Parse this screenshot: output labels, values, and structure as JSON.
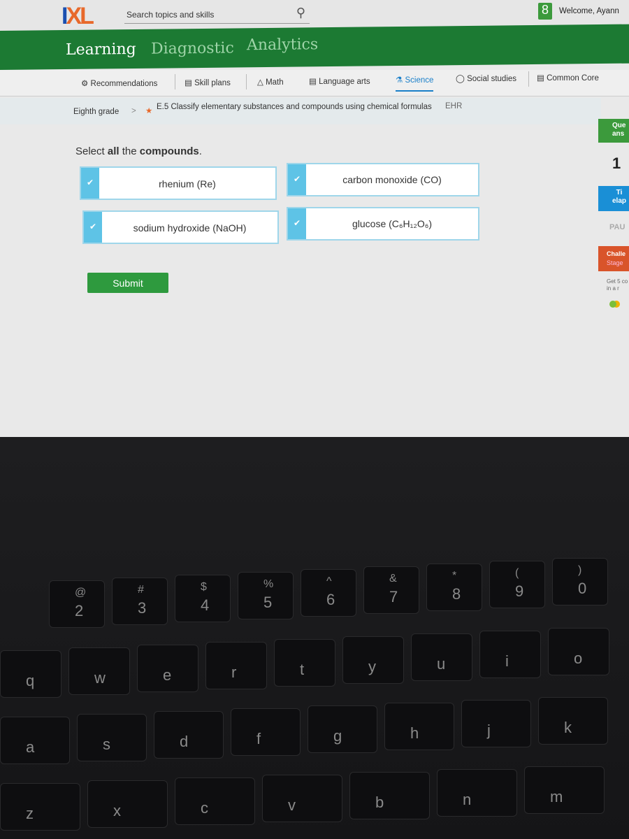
{
  "header": {
    "logo": "IXL",
    "search_placeholder": "Search topics and skills",
    "avatar_glyph": "8",
    "welcome": "Welcome, Ayann"
  },
  "main_nav": [
    {
      "label": "Learning",
      "active": true
    },
    {
      "label": "Diagnostic"
    },
    {
      "label": "Analytics"
    }
  ],
  "sub_nav": [
    {
      "label": "Recommendations",
      "icon": "recommendations-icon"
    },
    {
      "label": "Skill plans",
      "icon": "skill-plans-icon"
    },
    {
      "label": "Math",
      "icon": "math-icon"
    },
    {
      "label": "Language arts",
      "icon": "book-icon"
    },
    {
      "label": "Science",
      "icon": "flask-icon",
      "active": true
    },
    {
      "label": "Social studies",
      "icon": "globe-icon"
    },
    {
      "label": "Common Core",
      "icon": "clipboard-icon"
    }
  ],
  "breadcrumb": {
    "grade": "Eighth grade",
    "separator": ">",
    "skill": "E.5 Classify elementary substances and compounds using chemical formulas",
    "code": "EHR"
  },
  "question": {
    "prompt_pre": "Select ",
    "prompt_bold1": "all",
    "prompt_mid": " the ",
    "prompt_bold2": "compounds",
    "prompt_end": ".",
    "choices": [
      {
        "label": "rhenium (Re)",
        "selected": true
      },
      {
        "label": "carbon monoxide (CO)",
        "selected": true
      },
      {
        "label": "sodium hydroxide (NaOH)",
        "selected": true
      },
      {
        "label": "glucose (C₆H₁₂O₆)",
        "selected": true
      }
    ],
    "submit": "Submit"
  },
  "sidebar": {
    "questions_label": "Que ans",
    "questions_value": "1",
    "time_label": "Ti elap",
    "pause": "PAU",
    "challenge": "Challe",
    "stage": "Stage",
    "challenge_desc": "Get 5 co in a r",
    "colors": {
      "questions": "#3c9a3c",
      "time": "#1a8fd6",
      "challenge": "#d9542a"
    }
  },
  "keyboard": {
    "keys": [
      {
        "s": "@",
        "m": "2"
      },
      {
        "s": "#",
        "m": "3"
      },
      {
        "s": "$",
        "m": "4"
      },
      {
        "s": "%",
        "m": "5"
      },
      {
        "s": "^",
        "m": "6"
      },
      {
        "s": "&",
        "m": "7"
      },
      {
        "s": "*",
        "m": "8"
      },
      {
        "s": "(",
        "m": "9"
      },
      {
        "s": ")",
        "m": "0"
      },
      {
        "m": "q"
      },
      {
        "m": "w"
      },
      {
        "m": "e"
      },
      {
        "m": "r"
      },
      {
        "m": "t"
      },
      {
        "m": "y"
      },
      {
        "m": "u"
      },
      {
        "m": "i"
      },
      {
        "m": "o"
      },
      {
        "m": "a"
      },
      {
        "m": "s"
      },
      {
        "m": "d"
      },
      {
        "m": "f"
      },
      {
        "m": "g"
      },
      {
        "m": "h"
      },
      {
        "m": "j"
      },
      {
        "m": "k"
      },
      {
        "m": "z"
      },
      {
        "m": "x"
      },
      {
        "m": "c"
      },
      {
        "m": "v"
      },
      {
        "m": "b"
      },
      {
        "m": "n"
      },
      {
        "m": "m"
      }
    ]
  }
}
